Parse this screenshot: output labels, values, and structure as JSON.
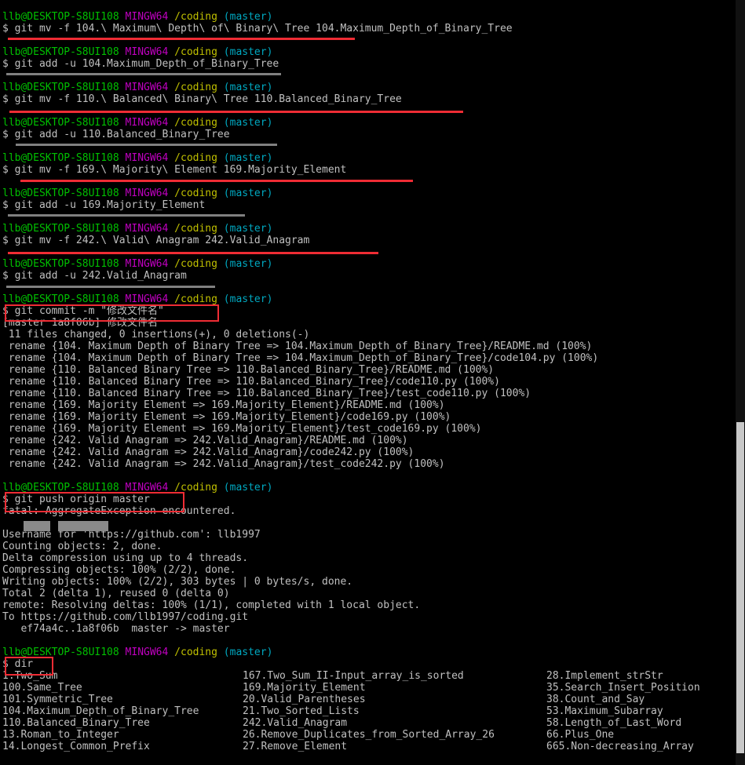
{
  "prompt": {
    "user": "llb@DESKTOP-S8UI108",
    "shell": "MINGW64",
    "cwd": "/coding",
    "branch": "(master)"
  },
  "commands": {
    "c1": "$ git mv -f 104.\\ Maximum\\ Depth\\ of\\ Binary\\ Tree 104.Maximum_Depth_of_Binary_Tree",
    "c2": "$ git add -u 104.Maximum_Depth_of_Binary_Tree",
    "c3": "$ git mv -f 110.\\ Balanced\\ Binary\\ Tree 110.Balanced_Binary_Tree",
    "c4": "$ git add -u 110.Balanced_Binary_Tree",
    "c5": "$ git mv -f 169.\\ Majority\\ Element 169.Majority_Element",
    "c6": "$ git add -u 169.Majority_Element",
    "c7": "$ git mv -f 242.\\ Valid\\ Anagram 242.Valid_Anagram",
    "c8": "$ git add -u 242.Valid_Anagram",
    "c9": "$ git commit -m \"修改文件名\"",
    "c10": "$ git push origin master",
    "c11": "$ dir"
  },
  "commit_output": [
    "[master 1a8f06b] 修改文件名",
    " 11 files changed, 0 insertions(+), 0 deletions(-)",
    " rename {104. Maximum Depth of Binary Tree => 104.Maximum_Depth_of_Binary_Tree}/README.md (100%)",
    " rename {104. Maximum Depth of Binary Tree => 104.Maximum_Depth_of_Binary_Tree}/code104.py (100%)",
    " rename {110. Balanced Binary Tree => 110.Balanced_Binary_Tree}/README.md (100%)",
    " rename {110. Balanced Binary Tree => 110.Balanced_Binary_Tree}/code110.py (100%)",
    " rename {110. Balanced Binary Tree => 110.Balanced_Binary_Tree}/test_code110.py (100%)",
    " rename {169. Majority Element => 169.Majority_Element}/README.md (100%)",
    " rename {169. Majority Element => 169.Majority_Element}/code169.py (100%)",
    " rename {169. Majority Element => 169.Majority_Element}/test_code169.py (100%)",
    " rename {242. Valid Anagram => 242.Valid_Anagram}/README.md (100%)",
    " rename {242. Valid Anagram => 242.Valid_Anagram}/code242.py (100%)",
    " rename {242. Valid Anagram => 242.Valid_Anagram}/test_code242.py (100%)"
  ],
  "push_output": [
    "fatal: AggregateException encountered.",
    "",
    "Username for 'https://github.com': llb1997",
    "Counting objects: 2, done.",
    "Delta compression using up to 4 threads.",
    "Compressing objects: 100% (2/2), done.",
    "Writing objects: 100% (2/2), 303 bytes | 0 bytes/s, done.",
    "Total 2 (delta 1), reused 0 (delta 0)",
    "remote: Resolving deltas: 100% (1/1), completed with 1 local object.",
    "To https://github.com/llb1997/coding.git",
    "   ef74a4c..1a8f06b  master -> master"
  ],
  "dir_rows": [
    [
      "1.Two_Sum",
      "167.Two_Sum_II-Input_array_is_sorted",
      "28.Implement_strStr"
    ],
    [
      "100.Same_Tree",
      "169.Majority_Element",
      "35.Search_Insert_Position"
    ],
    [
      "101.Symmetric_Tree",
      "20.Valid_Parentheses",
      "38.Count_and_Say"
    ],
    [
      "104.Maximum_Depth_of_Binary_Tree",
      "21.Two_Sorted_Lists",
      "53.Maximum_Subarray"
    ],
    [
      "110.Balanced_Binary_Tree",
      "242.Valid_Anagram",
      "58.Length_of_Last_Word"
    ],
    [
      "13.Roman_to_Integer",
      "26.Remove_Duplicates_from_Sorted_Array_26",
      "66.Plus_One"
    ],
    [
      "14.Longest_Common_Prefix",
      "27.Remove_Element",
      "665.Non-decreasing_Array"
    ]
  ],
  "colors": {
    "background": "#000000",
    "text": "#c0c0c0",
    "user": "#00c000",
    "shell": "#c000c0",
    "cwd": "#c0c000",
    "branch": "#00a8c0",
    "highlight": "#ef2c34",
    "underline_gray": "#808080"
  }
}
